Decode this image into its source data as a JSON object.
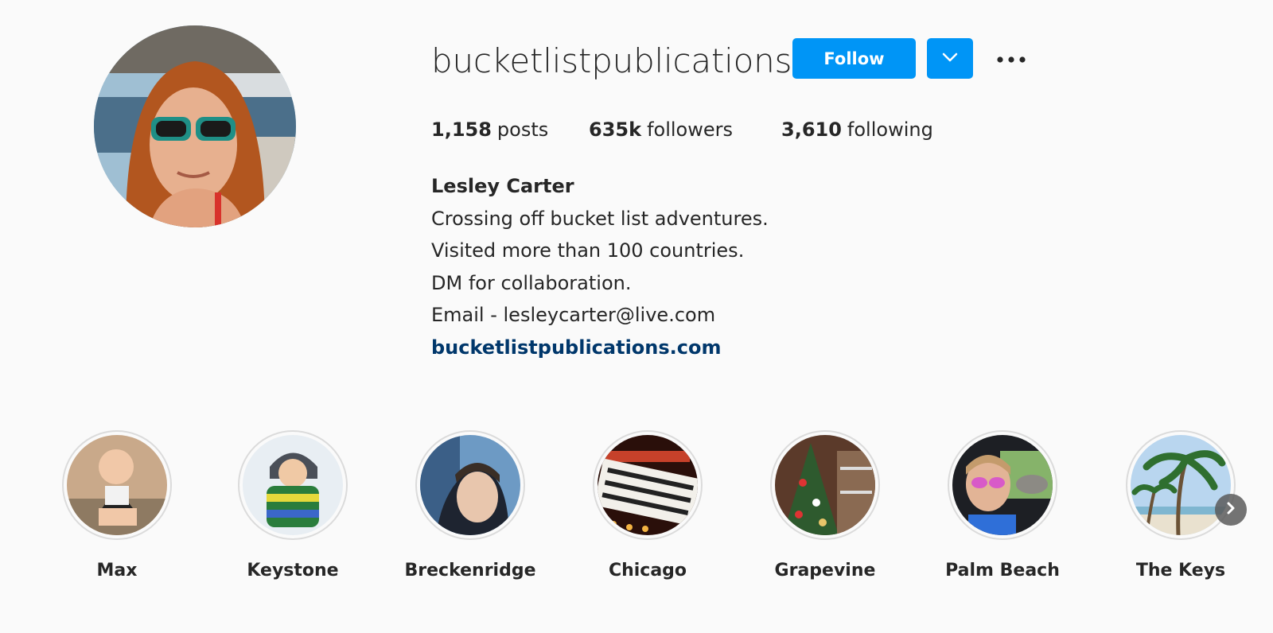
{
  "profile": {
    "username": "bucketlistpublications",
    "follow_label": "Follow",
    "avatar_icon": "profile-photo",
    "accent_color": "#0095f6"
  },
  "stats": {
    "posts_count": "1,158",
    "posts_label": "posts",
    "followers_count": "635k",
    "followers_label": "followers",
    "following_count": "3,610",
    "following_label": "following"
  },
  "bio": {
    "name": "Lesley Carter",
    "lines": [
      "Crossing off bucket list adventures.",
      "Visited more than 100 countries.",
      "DM for collaboration.",
      "Email - lesleycarter@live.com"
    ],
    "link": "bucketlistpublications.com"
  },
  "highlights": [
    {
      "label": "Max"
    },
    {
      "label": "Keystone"
    },
    {
      "label": "Breckenridge"
    },
    {
      "label": "Chicago"
    },
    {
      "label": "Grapevine"
    },
    {
      "label": "Palm Beach"
    },
    {
      "label": "The Keys"
    }
  ]
}
